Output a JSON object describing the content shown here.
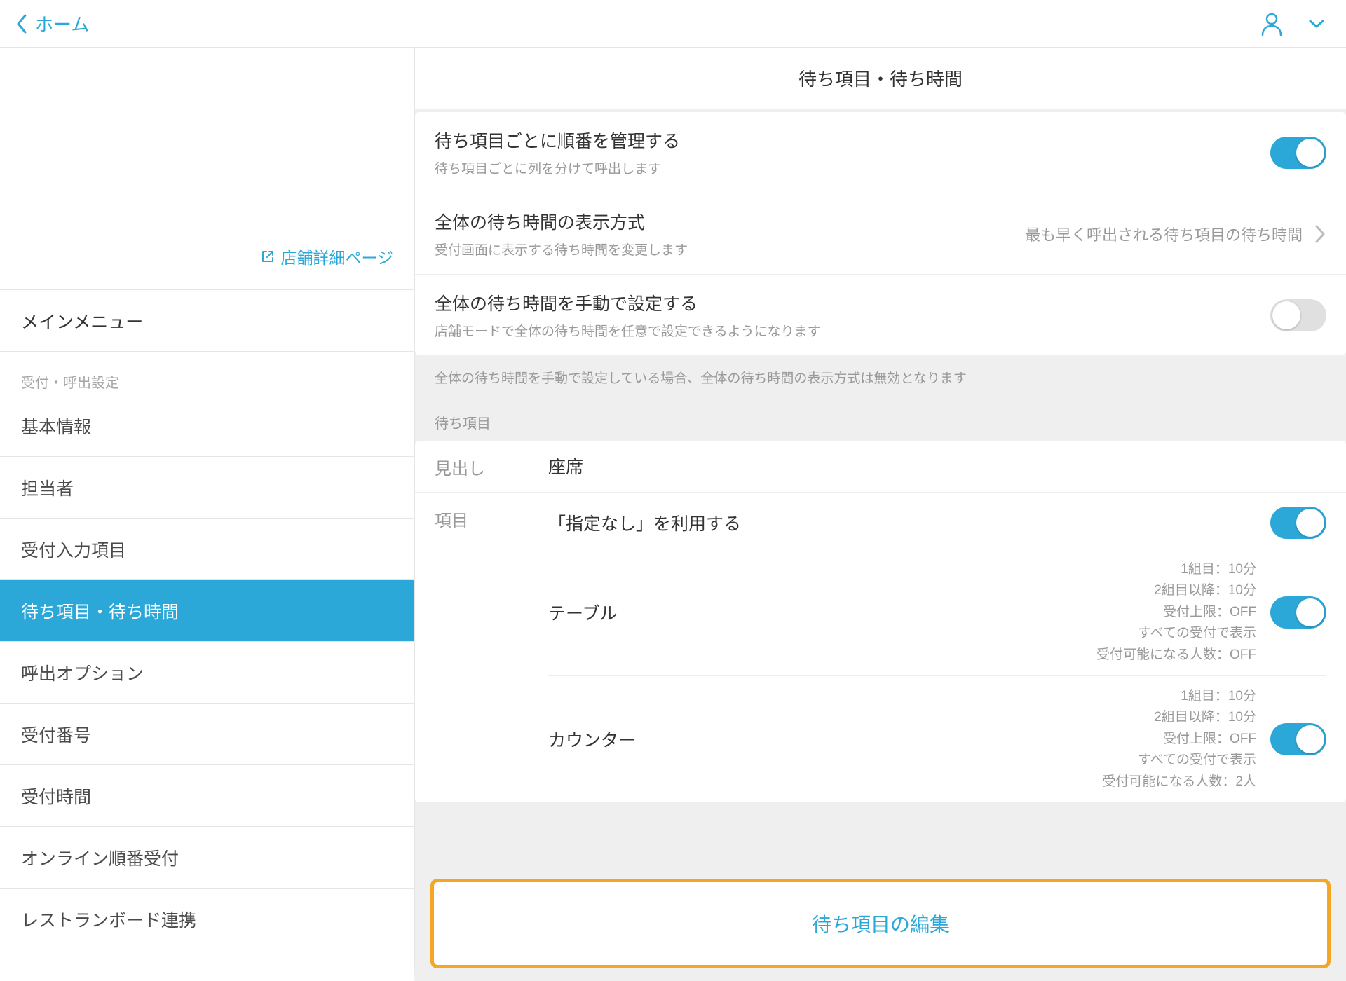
{
  "topbar": {
    "back": "ホーム"
  },
  "sidebar": {
    "shop_link": "店舗詳細ページ",
    "main_menu": "メインメニュー",
    "section1": "受付・呼出設定",
    "items": [
      {
        "label": "基本情報"
      },
      {
        "label": "担当者"
      },
      {
        "label": "受付入力項目"
      },
      {
        "label": "待ち項目・待ち時間"
      },
      {
        "label": "呼出オプション"
      },
      {
        "label": "受付番号"
      },
      {
        "label": "受付時間"
      },
      {
        "label": "オンライン順番受付"
      },
      {
        "label": "レストランボード連携"
      }
    ]
  },
  "content": {
    "title": "待ち項目・待ち時間",
    "settings": [
      {
        "title": "待ち項目ごとに順番を管理する",
        "sub": "待ち項目ごとに列を分けて呼出します",
        "toggle": "on"
      },
      {
        "title": "全体の待ち時間の表示方式",
        "sub": "受付画面に表示する待ち時間を変更します",
        "value": "最も早く呼出される待ち項目の待ち時間"
      },
      {
        "title": "全体の待ち時間を手動で設定する",
        "sub": "店舗モードで全体の待ち時間を任意で設定できるようになります",
        "toggle": "off"
      }
    ],
    "note": "全体の待ち時間を手動で設定している場合、全体の待ち時間の表示方式は無効となります",
    "wait_section_label": "待ち項目",
    "heading_label": "見出し",
    "heading_value": "座席",
    "item_label": "項目",
    "unspecified": {
      "label": "「指定なし」を利用する",
      "toggle": "on"
    },
    "items": [
      {
        "name": "テーブル",
        "lines": [
          "1組目：10分",
          "2組目以降：10分",
          "受付上限：OFF",
          "すべての受付で表示",
          "受付可能になる人数：OFF"
        ],
        "toggle": "on"
      },
      {
        "name": "カウンター",
        "lines": [
          "1組目：10分",
          "2組目以降：10分",
          "受付上限：OFF",
          "すべての受付で表示",
          "受付可能になる人数：2人"
        ],
        "toggle": "on"
      }
    ],
    "edit_button": "待ち項目の編集"
  }
}
